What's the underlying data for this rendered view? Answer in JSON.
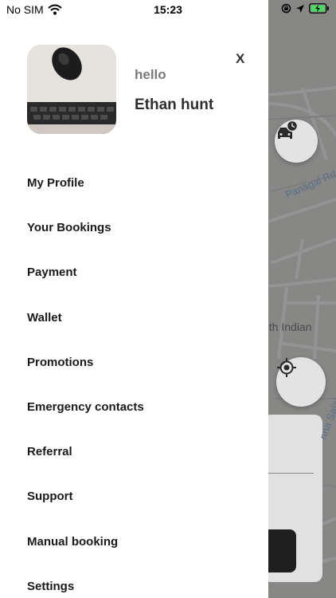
{
  "status_bar": {
    "carrier": "No SIM",
    "time": "15:23"
  },
  "drawer": {
    "greeting": "hello",
    "user_name": "Ethan hunt",
    "close_label": "X",
    "menu_items": [
      "My Profile",
      "Your Bookings",
      "Payment",
      "Wallet",
      "Promotions",
      "Emergency contacts",
      "Referral",
      "Support",
      "Manual booking",
      "Settings"
    ]
  },
  "map": {
    "road_label": "Panagal Rd",
    "area_label": "uth Indian",
    "road_label_2": "nna Salai"
  },
  "icons": {
    "wifi": "wifi-icon",
    "location_lock": "orientation-lock-icon",
    "location_arrow": "location-arrow-icon",
    "battery": "battery-charging-icon",
    "filter": "filter-icon",
    "scheduled_ride": "car-clock-icon",
    "my_location": "crosshair-icon"
  },
  "colors": {
    "drawer_bg": "#ffffff",
    "overlay": "#6e6e6e",
    "battery": "#4cd964",
    "text_primary": "#1a1a1a",
    "text_secondary": "#7a7a7a"
  }
}
